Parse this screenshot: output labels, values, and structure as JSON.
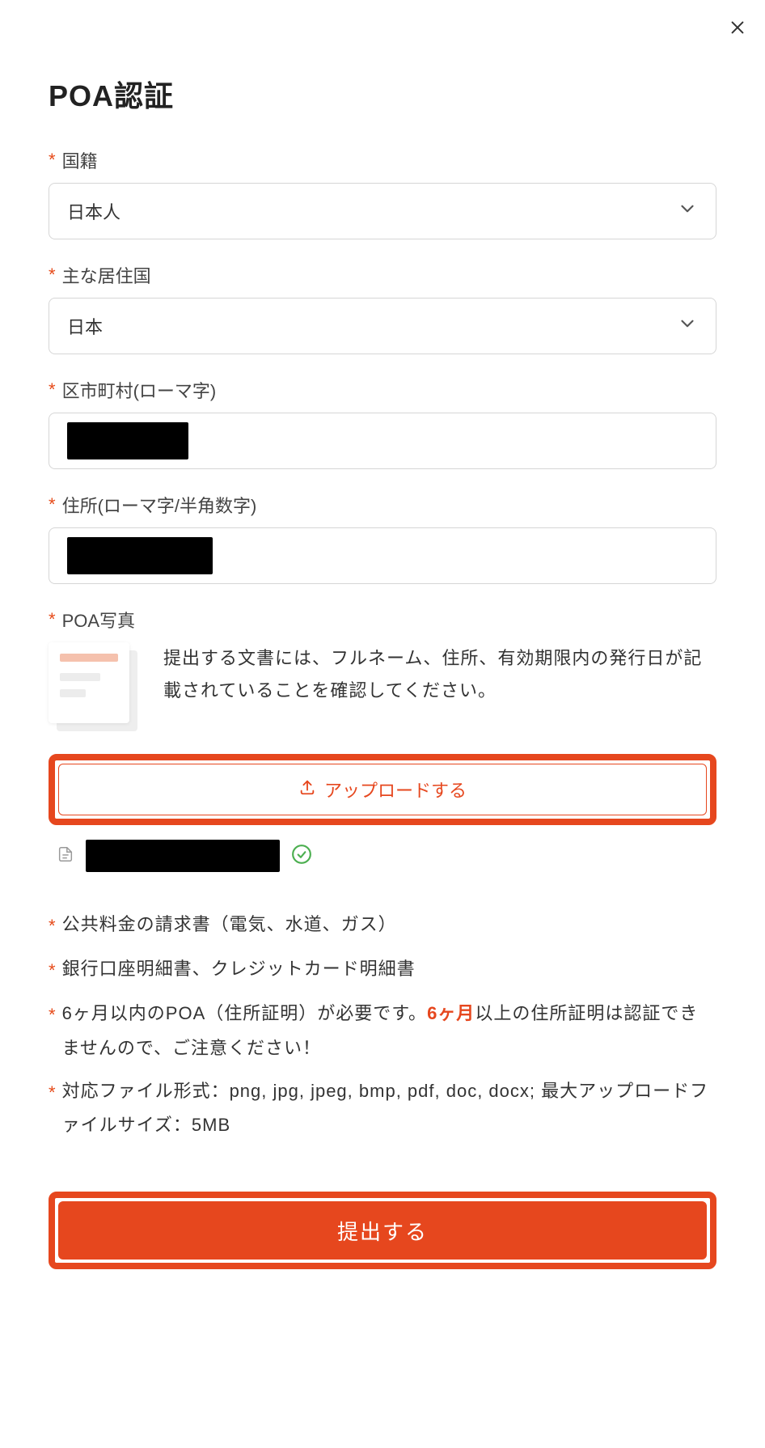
{
  "title": "POA認証",
  "close_label": "×",
  "fields": {
    "nationality": {
      "label": "国籍",
      "value": "日本人"
    },
    "residence": {
      "label": "主な居住国",
      "value": "日本"
    },
    "city": {
      "label": "区市町村(ローマ字)",
      "value_redacted": true
    },
    "address": {
      "label": "住所(ローマ字/半角数字)",
      "value_redacted": true
    },
    "photo": {
      "label": "POA写真",
      "description": "提出する文書には、フルネーム、住所、有効期限内の発行日が記載されていることを確認してください。"
    }
  },
  "upload": {
    "button_label": "アップロードする",
    "uploaded_filename_redacted": true,
    "upload_status": "success"
  },
  "notes": {
    "n1": "公共料金の請求書（電気、水道、ガス）",
    "n2": "銀行口座明細書、クレジットカード明細書",
    "n3_pre": "6ヶ月以内のPOA（住所証明）が必要です。",
    "n3_em": "6ヶ月",
    "n3_post": "以上の住所証明は認証できませんので、ご注意ください！",
    "n4": "対応ファイル形式：png, jpg, jpeg, bmp, pdf, doc, docx; 最大アップロードファイルサイズ：5MB"
  },
  "submit_label": "提出する",
  "required_marker": "*"
}
